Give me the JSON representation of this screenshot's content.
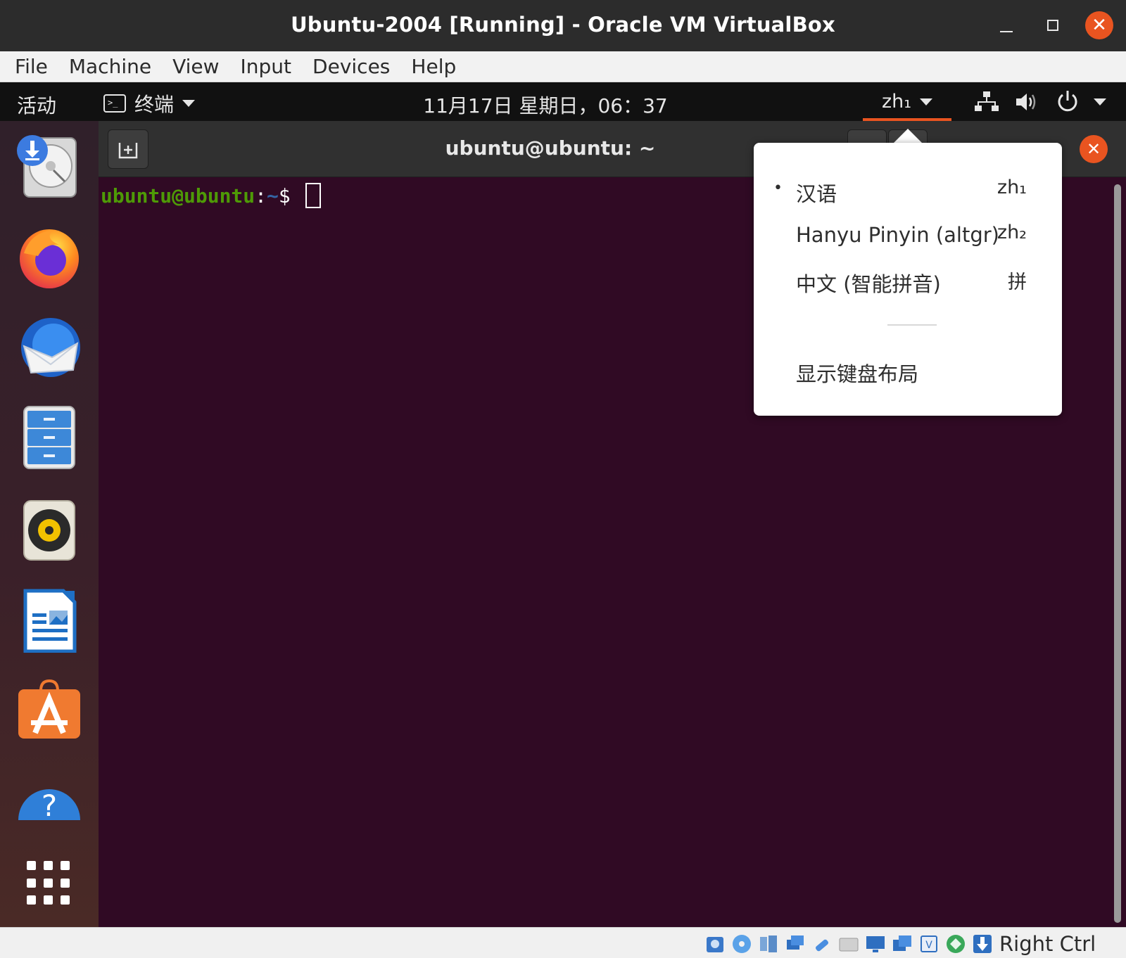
{
  "host": {
    "title": "Ubuntu-2004 [Running] - Oracle VM VirtualBox",
    "window_controls": {
      "minimize": "minimize-icon",
      "maximize": "maximize-icon",
      "close": "close-icon"
    },
    "menu": [
      "File",
      "Machine",
      "View",
      "Input",
      "Devices",
      "Help"
    ],
    "status_bar": {
      "icons": [
        "hard-disk-icon",
        "optical-drive-icon",
        "audio-icon",
        "network-icon",
        "usb-icon",
        "shared-folder-icon",
        "display-icon",
        "recording-icon",
        "cpu-icon",
        "mouse-integration-icon",
        "keyboard-capture-icon"
      ],
      "host_key": "Right Ctrl"
    }
  },
  "panel": {
    "activities": "活动",
    "app_menu": "终端",
    "clock": "11月17日 星期日，06：37",
    "ime_indicator": "zh₁",
    "accent": "#e95420"
  },
  "dock": {
    "items": [
      "installer-icon",
      "firefox-icon",
      "thunderbird-icon",
      "files-icon",
      "rhythmbox-icon",
      "writer-icon",
      "software-icon",
      "help-icon"
    ],
    "show_apps": "show-apps-icon"
  },
  "terminal": {
    "title": "ubuntu@ubuntu: ~",
    "prompt_user": "ubuntu@ubuntu",
    "prompt_sep": ":",
    "prompt_path": "~",
    "prompt_symbol": "$ ",
    "background": "#300a24"
  },
  "ime_menu": {
    "items": [
      {
        "label": "汉语",
        "code": "zh₁",
        "active": true
      },
      {
        "label": "Hanyu Pinyin (altgr)",
        "code": "zh₂",
        "active": false
      },
      {
        "label": "中文 (智能拼音)",
        "code": "拼",
        "active": false
      }
    ],
    "show_layout": "显示键盘布局",
    "active_marker": "•"
  }
}
